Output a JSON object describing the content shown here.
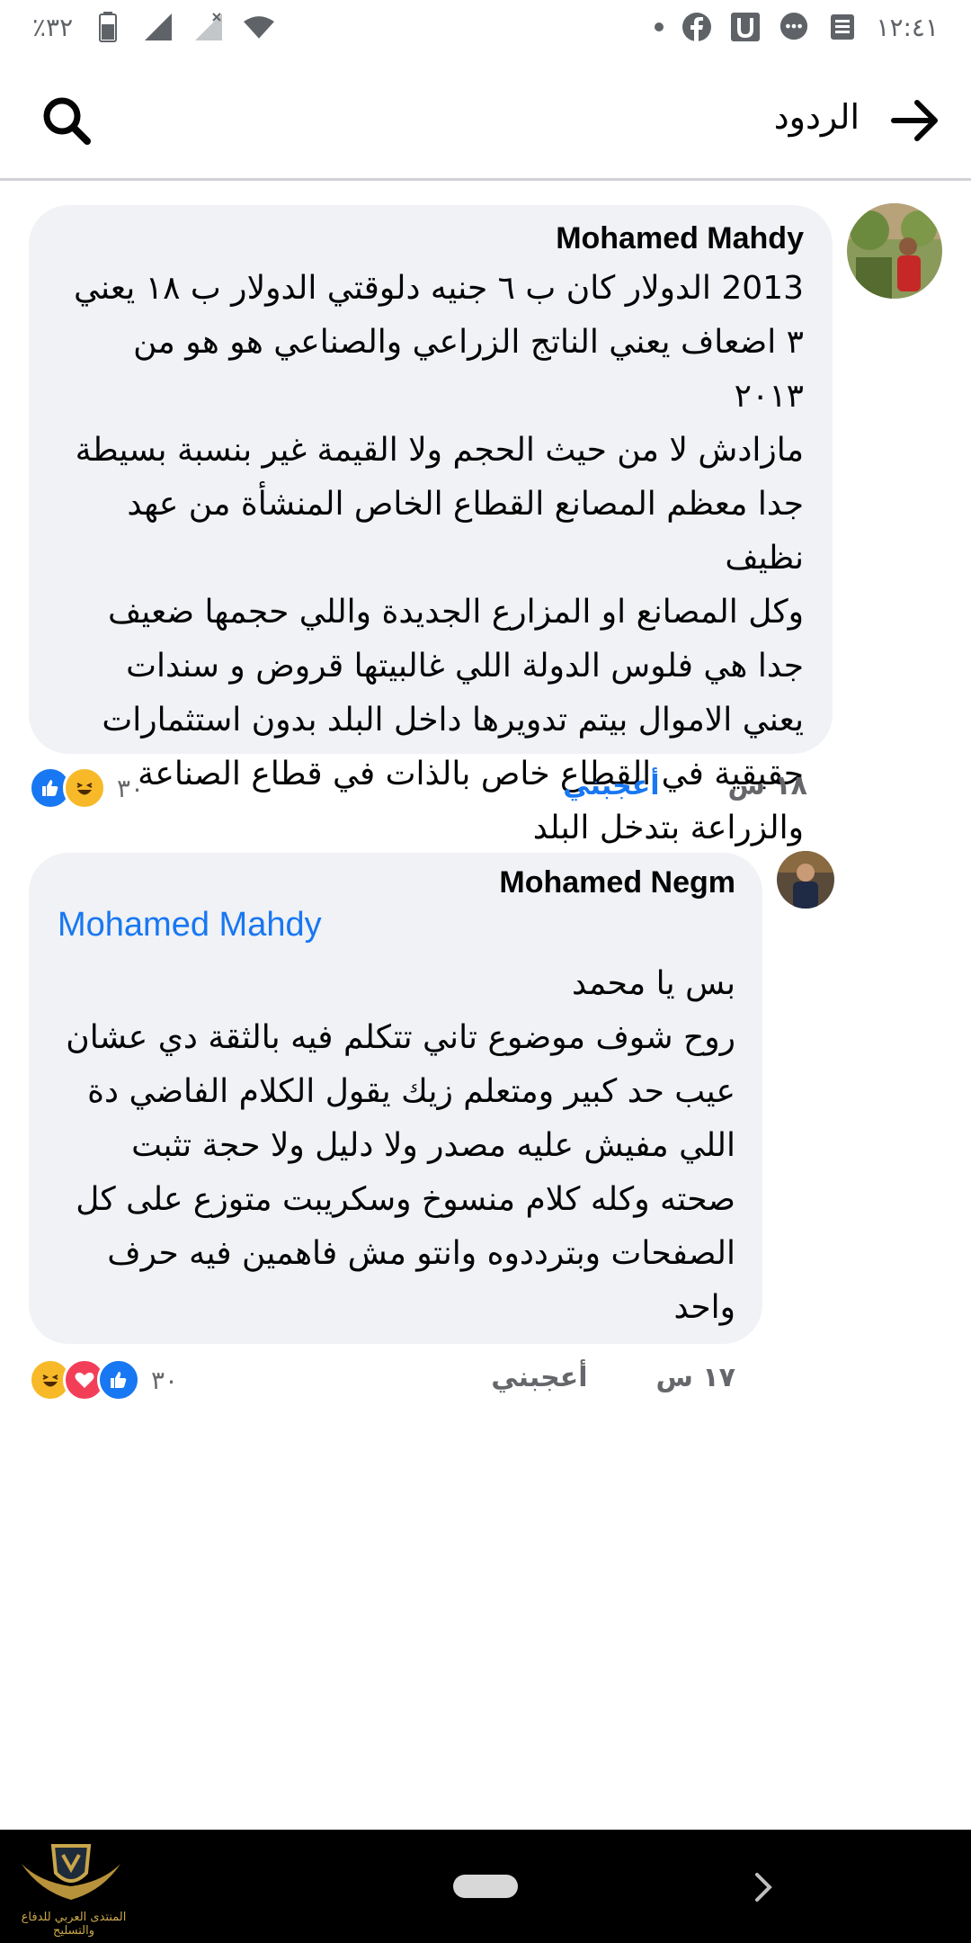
{
  "status_bar": {
    "time": "١٢:٤١",
    "battery": "٪٣٢"
  },
  "header": {
    "title": "الردود",
    "icons": [
      "arrow-right-icon",
      "search-icon"
    ]
  },
  "comments": [
    {
      "author": "Mohamed Mahdy",
      "mention": "",
      "text": "2013 الدولار كان ب ٦ جنيه دلوقتي الدولار ب ١٨ يعني\n٣ اضعاف يعني الناتج الزراعي والصناعي هو هو من ٢٠١٣\nمازادش لا من حيث الحجم ولا القيمة غير بنسبة بسيطة\nجدا معظم المصانع القطاع الخاص المنشأة من عهد نظيف\nوكل المصانع او المزارع الجديدة واللي حجمها ضعيف\nجدا هي فلوس الدولة اللي غالبيتها قروض و سندات\nيعني الاموال بيتم تدويرها داخل البلد بدون استثمارات\nحقيقية في القطاع خاص بالذات في قطاع الصناعة\nوالزراعة بتدخل البلد",
      "time": "١٨ س",
      "like_label": "أعجبني",
      "liked": true,
      "reaction_count": "٣٠",
      "reactions": [
        "haha",
        "like"
      ]
    },
    {
      "author": "Mohamed Negm",
      "mention": "Mohamed Mahdy",
      "text": "بس يا محمد\nروح شوف موضوع تاني تتكلم فيه بالثقة دي عشان\nعيب حد كبير ومتعلم زيك يقول الكلام الفاضي دة\nاللي مفيش عليه مصدر ولا دليل ولا حجة تثبت\nصحته وكله كلام منسوخ وسكريبت متوزع على كل\nالصفحات وبترددوه وانتو مش فاهمين فيه حرف\nواحد",
      "time": "١٧ س",
      "like_label": "أعجبني",
      "liked": false,
      "reaction_count": "٣٠",
      "reactions": [
        "like",
        "love",
        "haha"
      ]
    }
  ],
  "watermark": {
    "text": "المنتدى العربي للدفاع والتسليح"
  },
  "colors": {
    "accent": "#1877f2",
    "bubble": "#f0f2f5",
    "meta": "#65676b"
  }
}
